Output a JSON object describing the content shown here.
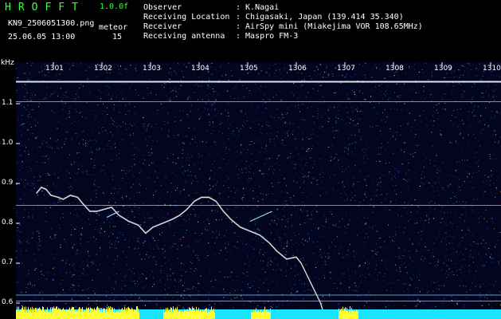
{
  "app": {
    "title": "HROFFT",
    "version": "1.0.0f",
    "filename": "KN9_2506051300.png",
    "timestamp": "25.06.05 13:00",
    "mode_label": "meteor",
    "mode_value": "15"
  },
  "info": [
    {
      "label": "Observer",
      "value": ": K.Nagai"
    },
    {
      "label": "Receiving Location",
      "value": ": Chigasaki, Japan (139.414 35.340)"
    },
    {
      "label": "Receiver",
      "value": ": AirSpy mini (Miakejima VOR 108.65MHz)"
    },
    {
      "label": "Receiving antenna",
      "value": ": Maspro FM-3"
    }
  ],
  "colors": {
    "title": "#39ff39",
    "background": "#03041e",
    "baseline_cyan": "#19e5ff",
    "baseline_yellow": "#ffff33",
    "trace": "#c8e6ff"
  },
  "chart_data": {
    "type": "heatmap",
    "xlabel": "",
    "ylabel": "kHz",
    "x_ticks": [
      "1301",
      "1302",
      "1303",
      "1304",
      "1305",
      "1306",
      "1307",
      "1308",
      "1309",
      "1310"
    ],
    "y_ticks": [
      "1.1",
      "1.0",
      "0.9",
      "0.8",
      "0.7",
      "0.6"
    ],
    "ylim": [
      0.58,
      1.17
    ],
    "xlim": [
      1300.6,
      1310.3
    ],
    "horizontal_lines_khz": [
      1.155,
      1.105,
      0.845,
      0.62,
      0.605
    ],
    "trace": [
      [
        1300.65,
        0.875
      ],
      [
        1300.75,
        0.89
      ],
      [
        1300.85,
        0.885
      ],
      [
        1300.95,
        0.87
      ],
      [
        1301.1,
        0.865
      ],
      [
        1301.2,
        0.86
      ],
      [
        1301.35,
        0.87
      ],
      [
        1301.5,
        0.865
      ],
      [
        1301.6,
        0.85
      ],
      [
        1301.75,
        0.83
      ],
      [
        1301.9,
        0.83
      ],
      [
        1302.05,
        0.835
      ],
      [
        1302.2,
        0.84
      ],
      [
        1302.35,
        0.82
      ],
      [
        1302.55,
        0.805
      ],
      [
        1302.75,
        0.795
      ],
      [
        1302.9,
        0.775
      ],
      [
        1303.05,
        0.79
      ],
      [
        1303.25,
        0.8
      ],
      [
        1303.45,
        0.81
      ],
      [
        1303.6,
        0.82
      ],
      [
        1303.75,
        0.835
      ],
      [
        1303.9,
        0.855
      ],
      [
        1304.05,
        0.865
      ],
      [
        1304.2,
        0.865
      ],
      [
        1304.35,
        0.855
      ],
      [
        1304.5,
        0.83
      ],
      [
        1304.65,
        0.81
      ],
      [
        1304.85,
        0.79
      ],
      [
        1305.05,
        0.78
      ],
      [
        1305.25,
        0.77
      ],
      [
        1305.45,
        0.75
      ],
      [
        1305.6,
        0.73
      ],
      [
        1305.8,
        0.71
      ],
      [
        1306.0,
        0.715
      ],
      [
        1306.1,
        0.7
      ],
      [
        1306.2,
        0.675
      ],
      [
        1306.3,
        0.65
      ],
      [
        1306.4,
        0.625
      ],
      [
        1306.5,
        0.6
      ],
      [
        1306.55,
        0.58
      ]
    ],
    "short_streaks": [
      [
        [
          1302.1,
          0.815
        ],
        [
          1302.35,
          0.83
        ]
      ],
      [
        [
          1305.05,
          0.805
        ],
        [
          1305.5,
          0.83
        ]
      ]
    ]
  }
}
